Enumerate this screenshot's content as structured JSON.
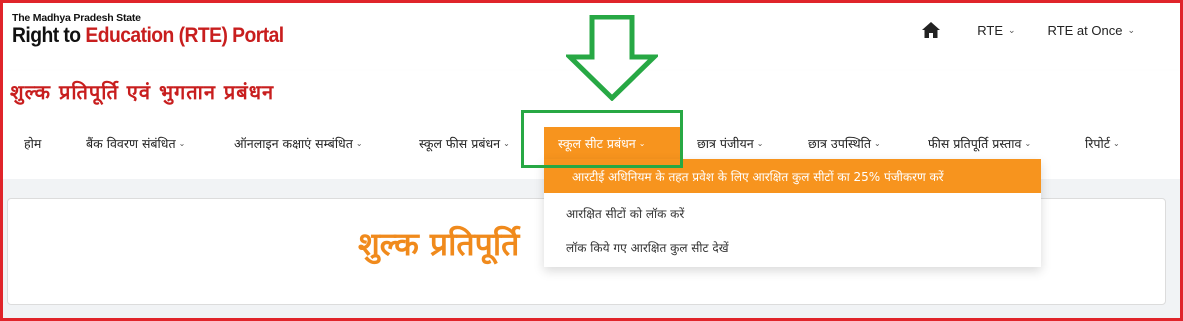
{
  "brand": {
    "logo_small": "The Madhya Pradesh State",
    "logo_big_prefix": "Right to ",
    "logo_big_main": "Education (RTE) Portal"
  },
  "topnav": {
    "home_icon": "home-icon",
    "items": [
      {
        "label": "RTE"
      },
      {
        "label": "RTE at Once"
      }
    ]
  },
  "page": {
    "heading": "शुल्क प्रतिपूर्ति एवं भुगतान प्रबंधन",
    "big_title": "शुल्क प्रतिपूर्ति"
  },
  "mainnav": {
    "items": [
      {
        "label": "होम",
        "has_dropdown": false
      },
      {
        "label": "बैंक विवरण संबंधित",
        "has_dropdown": true
      },
      {
        "label": "ऑनलाइन कक्षाएं सम्बंधित",
        "has_dropdown": true
      },
      {
        "label": "स्कूल फीस प्रबंधन",
        "has_dropdown": true
      },
      {
        "label": "स्कूल सीट प्रबंधन",
        "has_dropdown": true,
        "active": true
      },
      {
        "label": "छात्र पंजीयन",
        "has_dropdown": true
      },
      {
        "label": "छात्र उपस्थिति",
        "has_dropdown": true
      },
      {
        "label": "फीस प्रतिपूर्ति प्रस्ताव",
        "has_dropdown": true
      },
      {
        "label": "रिपोर्ट",
        "has_dropdown": true
      }
    ]
  },
  "dropdown": {
    "items": [
      {
        "label": "आरटीई अधिनियम के तहत प्रवेश के लिए आरक्षित कुल सीटों का 25% पंजीकरण करें",
        "highlighted": true
      },
      {
        "label": "आरक्षित सीटों को लॉक करें"
      },
      {
        "label": "लॉक किये गए आरक्षित कुल सीट देखें"
      }
    ]
  },
  "colors": {
    "border_red": "#e0242a",
    "brand_red": "#c81e1e",
    "accent_orange": "#f7941e",
    "annotation_green": "#27a844"
  }
}
